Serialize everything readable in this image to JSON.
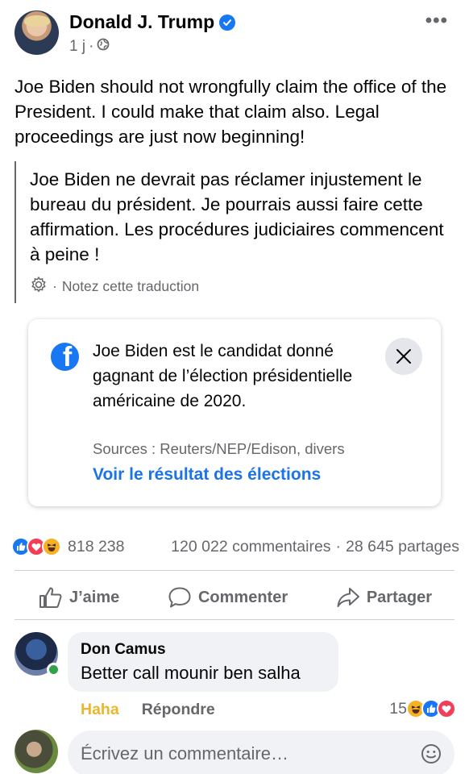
{
  "post": {
    "author": "Donald J. Trump",
    "time": "1 j",
    "separator": "·",
    "text": "Joe Biden should not wrongfully claim the office of the President. I could make that claim also. Legal proceedings are just now beginning!",
    "translation": "Joe Biden ne devrait pas réclamer injustement le bureau du président. Je pourrais aussi faire cette affirmation. Les procédures judiciaires commencent à peine !",
    "rate_translation": "Notez cette traduction",
    "rate_separator": "·"
  },
  "info_card": {
    "text": "Joe Biden est le candidat donné gagnant de l’élection présidentielle américaine de 2020.",
    "sources": "Sources : Reuters/NEP/Edison, divers",
    "link": "Voir le résultat des élections"
  },
  "stats": {
    "reactions_count": "818 238",
    "comments": "120 022 commentaires",
    "separator": "·",
    "shares": "28 645 partages"
  },
  "actions": {
    "like": "J’aime",
    "comment": "Commenter",
    "share": "Partager"
  },
  "comment": {
    "author": "Don Camus",
    "text": "Better call mounir ben salha",
    "reaction_label": "Haha",
    "reply": "Répondre",
    "reaction_count": "15"
  },
  "composer": {
    "placeholder": "Écrivez un commentaire…"
  },
  "colors": {
    "facebook_blue": "#1877f2",
    "link_blue": "#1b74e4",
    "secondary_text": "#65676b",
    "haha_yellow": "#e9b62f",
    "online_green": "#31a24c"
  }
}
